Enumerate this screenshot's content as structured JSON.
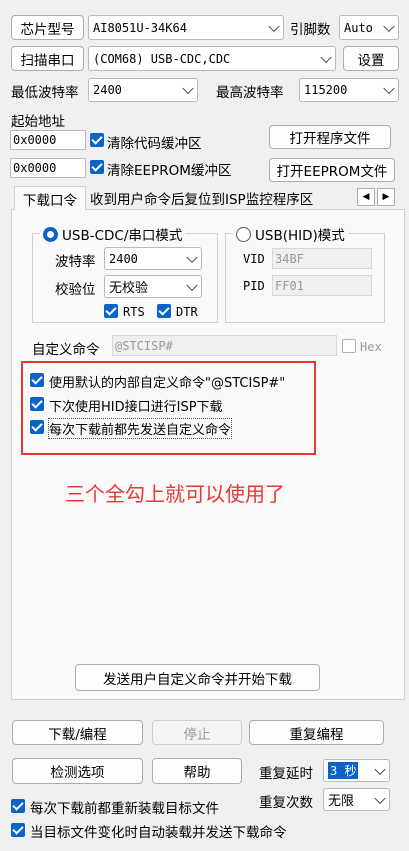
{
  "chip": {
    "label": "芯片型号",
    "value": "AI8051U-34K64",
    "pins_label": "引脚数",
    "pins_value": "Auto"
  },
  "port": {
    "scan_label": "扫描串口",
    "value": "(COM68) USB-CDC,CDC",
    "settings_label": "设置"
  },
  "baud": {
    "min_label": "最低波特率",
    "min_value": "2400",
    "max_label": "最高波特率",
    "max_value": "115200"
  },
  "address": {
    "label": "起始地址",
    "code_value": "0x0000",
    "code_clear_label": "清除代码缓冲区",
    "open_program_label": "打开程序文件",
    "eeprom_value": "0x0000",
    "eeprom_clear_label": "清除EEPROM缓冲区",
    "open_eeprom_label": "打开EEPROM文件"
  },
  "tabs": {
    "tab1": "下载口令",
    "tab2": "收到用户命令后复位到ISP监控程序区",
    "nav_left": "◀",
    "nav_right": "▶"
  },
  "serial_mode": {
    "label": "USB-CDC/串口模式",
    "baud_label": "波特率",
    "baud_value": "2400",
    "parity_label": "校验位",
    "parity_value": "无校验",
    "rts_label": "RTS",
    "dtr_label": "DTR"
  },
  "hid_mode": {
    "label": "USB(HID)模式",
    "vid_label": "VID",
    "vid_value": "34BF",
    "pid_label": "PID",
    "pid_value": "FF01"
  },
  "custom_cmd": {
    "label": "自定义命令",
    "placeholder": "@STCISP#",
    "hex_label": "Hex"
  },
  "options": {
    "opt1": "使用默认的内部自定义命令\"@STCISP#\"",
    "opt2": "下次使用HID接口进行ISP下载",
    "opt3": "每次下载前都先发送自定义命令"
  },
  "annotation": {
    "text": "三个全勾上就可以使用了",
    "color": "#e53935"
  },
  "send_button": "发送用户自定义命令并开始下载",
  "bottom": {
    "download_label": "下载/编程",
    "stop_label": "停止",
    "repeat_label": "重复编程",
    "detect_label": "检测选项",
    "help_label": "帮助",
    "repeat_delay_label": "重复延时",
    "repeat_delay_value": "3 秒",
    "repeat_count_label": "重复次数",
    "repeat_count_value": "无限",
    "reload_label": "每次下载前都重新装载目标文件",
    "auto_reload_label": "当目标文件变化时自动装载并发送下载命令"
  },
  "colors": {
    "accent": "#0a63c9",
    "highlight_box": "#e53935"
  }
}
